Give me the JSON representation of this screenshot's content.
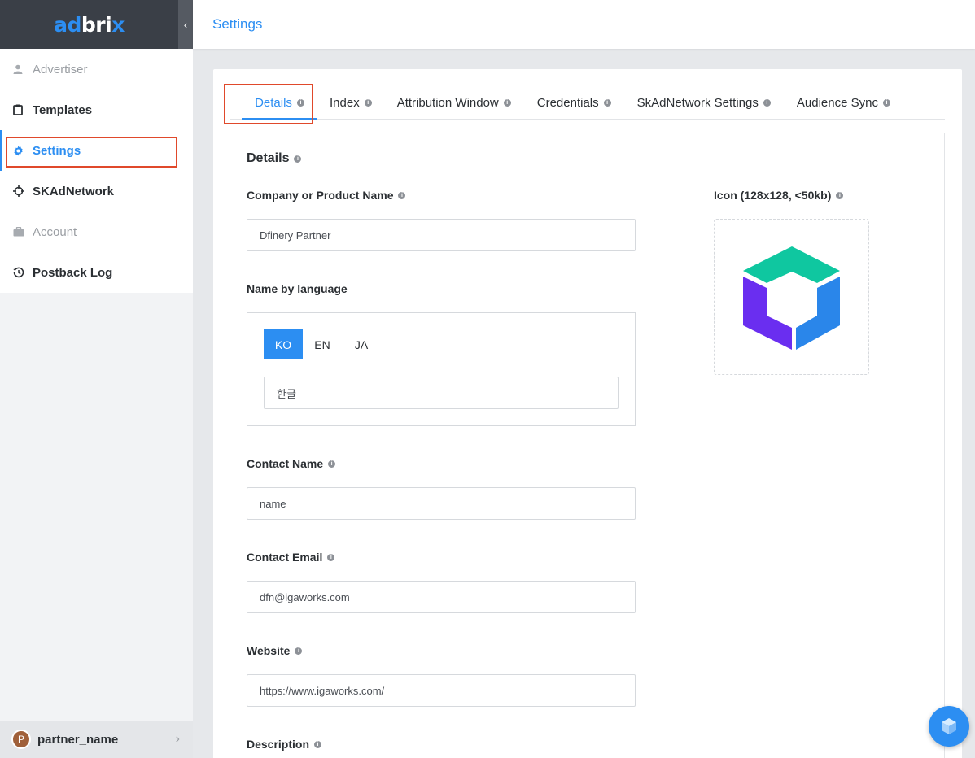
{
  "brand": {
    "logo_ad": "ad",
    "logo_bri": "bri",
    "logo_x": "x",
    "collapse_glyph": "‹"
  },
  "sidebar": {
    "items": [
      {
        "label": "Advertiser",
        "icon": "user-icon"
      },
      {
        "label": "Templates",
        "icon": "clipboard-icon"
      },
      {
        "label": "Settings",
        "icon": "gear-icon"
      },
      {
        "label": "SKAdNetwork",
        "icon": "crosshair-icon"
      },
      {
        "label": "Account",
        "icon": "briefcase-icon"
      },
      {
        "label": "Postback Log",
        "icon": "history-icon"
      }
    ]
  },
  "user": {
    "initial": "P",
    "name": "partner_name"
  },
  "header": {
    "title": "Settings"
  },
  "tabs": [
    {
      "label": "Details"
    },
    {
      "label": "Index"
    },
    {
      "label": "Attribution Window"
    },
    {
      "label": "Credentials"
    },
    {
      "label": "SkAdNetwork Settings"
    },
    {
      "label": "Audience Sync"
    }
  ],
  "details": {
    "title": "Details",
    "company_label": "Company or Product Name",
    "company_value": "Dfinery Partner",
    "name_by_language_label": "Name by language",
    "languages": [
      "KO",
      "EN",
      "JA"
    ],
    "active_language": "KO",
    "language_value": "한글",
    "contact_name_label": "Contact Name",
    "contact_name_placeholder": "name",
    "contact_email_label": "Contact Email",
    "contact_email_value": "dfn@igaworks.com",
    "website_label": "Website",
    "website_value": "https://www.igaworks.com/",
    "description_label": "Description",
    "icon_label": "Icon (128x128, <50kb)"
  },
  "colors": {
    "accent": "#2c8ef2",
    "highlight": "#e0492b",
    "cube_green": "#0fc7a0",
    "cube_purple": "#6a2ef0",
    "cube_blue": "#2a86ea"
  }
}
